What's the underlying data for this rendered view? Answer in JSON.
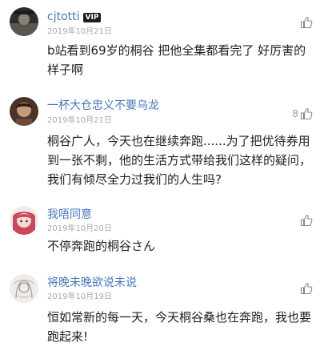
{
  "comments": [
    {
      "username": "cjtotti",
      "badge": "VIP",
      "date": "2019年10月21日",
      "text": "b站看到69岁的桐谷 把他全集都看完了 好厉害的样子啊",
      "likes": "",
      "avatar_icon": "user-avatar-icon",
      "avatar_color": "#3a3a3a"
    },
    {
      "username": "一杯大仓忠义不要乌龙",
      "badge": "",
      "date": "2019年10月21日",
      "text": "桐谷广人，今天也在继续奔跑......为了把优待券用到一张不剩，他的生活方式带给我们这样的疑问，我们有倾尽全力过我们的人生吗?",
      "likes": "8",
      "avatar_icon": "user-avatar-icon",
      "avatar_color": "#6b4a3a"
    },
    {
      "username": "我唔同意",
      "badge": "",
      "date": "2019年10月20日",
      "text": "不停奔跑的桐谷さん",
      "likes": "",
      "avatar_icon": "anime-avatar-icon",
      "avatar_color": "#d05a6a"
    },
    {
      "username": "将晚未晚欲说未说",
      "badge": "",
      "date": "2019年10月19日",
      "text": "恒如常新的每一天，今天桐谷桑也在奔跑，我也要跑起来!",
      "likes": "",
      "avatar_icon": "sketch-avatar-icon",
      "avatar_color": "#e6e0d8"
    }
  ],
  "like_icon": "thumbs-up-icon"
}
